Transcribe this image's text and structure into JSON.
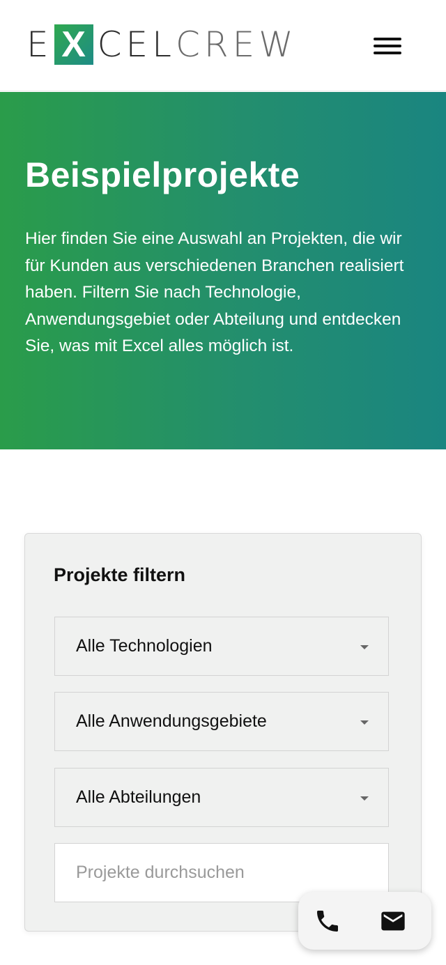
{
  "header": {
    "logo": {
      "part1": "E",
      "x": "X",
      "part2": "CEL",
      "part3": "CREW"
    },
    "menu_icon": "hamburger-menu-icon"
  },
  "hero": {
    "title": "Beispielprojekte",
    "text": "Hier finden Sie eine Auswahl an Projekten, die wir für Kunden aus verschiedenen Branchen realisiert haben. Filtern Sie nach Technologie, Anwendungsgebiet oder Abteilung und entdecken Sie, was mit Excel alles möglich ist.",
    "gradient_start": "#2a9c4a",
    "gradient_end": "#1a8580"
  },
  "filter": {
    "title": "Projekte filtern",
    "technology": {
      "selected": "Alle Technologien"
    },
    "area": {
      "selected": "Alle Anwendungsgebiete"
    },
    "department": {
      "selected": "Alle Abteilungen"
    },
    "search": {
      "placeholder": "Projekte durchsuchen",
      "value": ""
    }
  },
  "contact": {
    "phone_icon": "phone-icon",
    "mail_icon": "mail-icon"
  }
}
